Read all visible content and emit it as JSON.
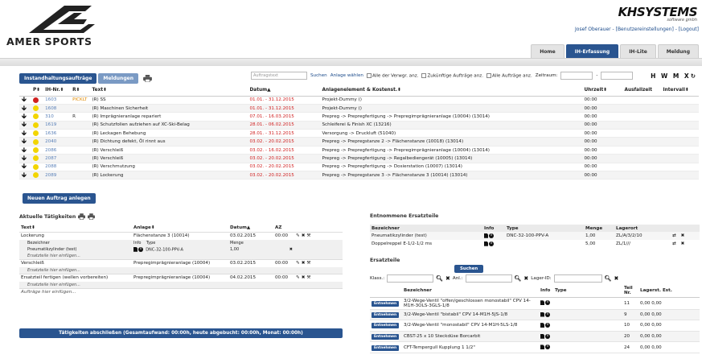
{
  "brand": {
    "logo_text": "AMER SPORTS",
    "khs_main": "KHSYSTEMS",
    "khs_sub": "software gmbh"
  },
  "user": {
    "line": "Josef Oberauer - [Benutzereinstellungen] - [Logout]"
  },
  "topnav": [
    "Home",
    "IH-Erfassung",
    "IH-Lite",
    "Meldung"
  ],
  "subtabs": [
    "Instandhaltungsaufträge",
    "Meldungen"
  ],
  "filter": {
    "auftrag_placeholder": "Auftragstext",
    "suchen": "Suchen",
    "anlage_waehlen": "Anlage wählen",
    "opt_verwgr": "Alle der Verwgr. anz.",
    "opt_zukuenftige": "Zukünftige Aufträge anz.",
    "opt_alle": "Alle Aufträge anz.",
    "zeitraum": "Zeitraum:",
    "zeitraum_sep": "-",
    "hwmx": "H W M X"
  },
  "maintable": {
    "headers": [
      "",
      "P",
      "IH-Nr.",
      "R",
      "Text",
      "Datum",
      "Anlagenelement & Kostenst.",
      "Uhrzeit",
      "Ausfallzeit",
      "Intervall"
    ],
    "rows": [
      {
        "dot": "#d02020",
        "nr": "1603",
        "r": "PICKLT",
        "text": "(R) SS",
        "datum": "01.01. - 31.12.2015",
        "anlage": "Projekt-Dummy ()",
        "uhrzeit": "00:00"
      },
      {
        "dot": "#f2d500",
        "nr": "1608",
        "r": "",
        "text": "(R) Maschinen Sicherheit",
        "datum": "01.01. - 31.12.2015",
        "anlage": "Projekt-Dummy ()",
        "uhrzeit": "00:00"
      },
      {
        "dot": "#f2d500",
        "nr": "310",
        "r": "R",
        "text": "(R) Imprägnieranlage repariert",
        "datum": "07.01. - 16.03.2015",
        "anlage": "Prepreg -> Prepregfertigung -> Prepregimprägnieranlage (10004) (13014)",
        "uhrzeit": "00:00"
      },
      {
        "dot": "#f2d500",
        "nr": "1619",
        "r": "",
        "text": "(R) Schutzfolien aufziehen auf XC-Ski-Belag",
        "datum": "28.01. - 06.02.2015",
        "anlage": "Schleiferei & Finish XC (13216)",
        "uhrzeit": "00:00"
      },
      {
        "dot": "#f2d500",
        "nr": "1636",
        "r": "",
        "text": "(R) Leckagen Behebung",
        "datum": "28.01. - 31.12.2015",
        "anlage": "Versorgung -> Druckluft (51040)",
        "uhrzeit": "00:00"
      },
      {
        "dot": "#f2d500",
        "nr": "2040",
        "r": "",
        "text": "(R) Dichtung defekt, Öl rinnt aus",
        "datum": "03.02. - 20.02.2015",
        "anlage": "Prepreg -> Prepregstanze 2 -> Flächenstanze (10018) (13014)",
        "uhrzeit": "00:00"
      },
      {
        "dot": "#f2d500",
        "nr": "2086",
        "r": "",
        "text": "(R) Verschleiß",
        "datum": "03.02. - 16.02.2015",
        "anlage": "Prepreg -> Prepregfertigung -> Prepregimprägnieranlage (10004) (13014)",
        "uhrzeit": "00:00"
      },
      {
        "dot": "#f2d500",
        "nr": "2087",
        "r": "",
        "text": "(R) Verschleiß",
        "datum": "03.02. - 20.02.2015",
        "anlage": "Prepreg -> Prepregfertigung -> Regalbediengerät (10005) (13014)",
        "uhrzeit": "00:00"
      },
      {
        "dot": "#f2d500",
        "nr": "2088",
        "r": "",
        "text": "(R) Verschmutzung",
        "datum": "03.02. - 20.02.2015",
        "anlage": "Prepreg -> Prepregfertigung -> Dosierstation (10007) (13014)",
        "uhrzeit": "00:00"
      },
      {
        "dot": "#f2d500",
        "nr": "2089",
        "r": "",
        "text": "(R) Lockerung",
        "datum": "03.02. - 20.02.2015",
        "anlage": "Prepreg -> Prepregstanze 3 -> Flächenstanze 3 (10014) (13014)",
        "uhrzeit": "00:00"
      }
    ]
  },
  "neu_button": "Neuen Auftrag anlegen",
  "taetigkeiten": {
    "title": "Aktuelle Tätigkeiten",
    "headers": [
      "Text",
      "Anlage",
      "Datum",
      "AZ"
    ],
    "rows": [
      {
        "text": "Lockerung",
        "anlage": "Flächenstanze 3 (10014)",
        "datum": "03.02.2015",
        "az": "00:00",
        "sub": {
          "h_bez": "Bezeichner",
          "h_info": "Info",
          "h_typ": "Type",
          "h_menge": "Menge",
          "bez": "Pneumatikzylinder (test)",
          "typ": "DNC-32-100-PPV-A",
          "menge": "1,00"
        },
        "hint": "Ersatzteile hier einfügen..."
      },
      {
        "text": "Verschleiß",
        "anlage": "Prepregimprägnieranlage (10004)",
        "datum": "03.02.2015",
        "az": "00:00",
        "hint": "Ersatzteile hier einfügen..."
      },
      {
        "text": "Ersatzteil fertigen (wellen vorbereiten)",
        "anlage": "Prepregimprägnieranlage (10004)",
        "datum": "04.02.2015",
        "az": "00:00",
        "hint": "Ersatzteile hier einfügen..."
      }
    ],
    "auftraege_hint": "Aufträge hier einfügen...",
    "finish": "Tätigkeiten abschließen (Gesamtaufwand: 00:00h, heute abgebucht: 00:00h, Monat: 00:00h)"
  },
  "entnommen": {
    "title": "Entnommene Ersatzteile",
    "headers": [
      "Bezeichner",
      "Info",
      "Type",
      "Menge",
      "Lagerort"
    ],
    "rows": [
      {
        "bez": "Pneumatikzylinder (test)",
        "typ": "DNC-32-100-PPV-A",
        "menge": "1,00",
        "lager": "ZL/A/3/2/10"
      },
      {
        "bez": "Doppelreppel E-1/2-1/2 ms",
        "typ": "",
        "menge": "5,00",
        "lager": "ZL/1///"
      }
    ]
  },
  "ersatzteile": {
    "title": "Ersatzteile",
    "suchen": "Suchen",
    "klass": "Klass.:",
    "anl": "Anl.:",
    "lager": "Lager-ID:",
    "headers": [
      "Bezeichner",
      "Info",
      "Type",
      "Teil Nr.",
      "Lagerst.",
      "Est."
    ],
    "btn": "Entnehmen",
    "rows": [
      {
        "bez": "3/2-Wege-Ventil \"offen/geschlossen monostabil\" CPV 14-M1H-3OLS-3GLS-1/8",
        "teil": "11",
        "lst": "0,00",
        "est": "0,00"
      },
      {
        "bez": "3/2-Wege-Ventil \"bistabil\" CPV 14-M1H-5JS-1/8",
        "teil": "9",
        "lst": "0,00",
        "est": "0,00"
      },
      {
        "bez": "3/2-Wege-Ventil \"monostabil\" CPV 14-M1H-5LS-1/8",
        "teil": "10",
        "lst": "0,00",
        "est": "0,00"
      },
      {
        "bez": "CBST-25 x 10 Steckdüse Borcarbit",
        "teil": "20",
        "lst": "0,00",
        "est": "0,00"
      },
      {
        "bez": "CFT-Tempergull Kupplung 1 1/2\"",
        "teil": "24",
        "lst": "0,00",
        "est": "0,00"
      }
    ]
  }
}
